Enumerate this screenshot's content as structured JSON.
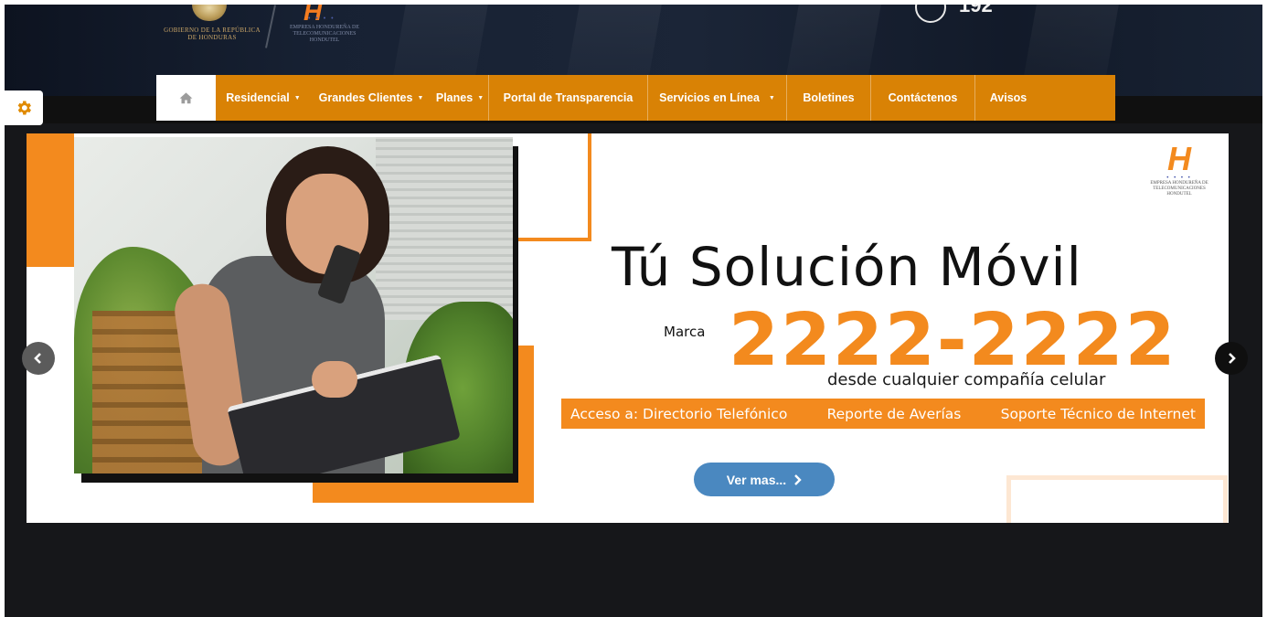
{
  "header": {
    "gov_text": "Gobierno de la República de Honduras",
    "brand_letter": "H",
    "brand_text": "Empresa Hondureña de Telecomunicaciones Hondutel",
    "phone_digits": "192"
  },
  "nav": {
    "home_icon": "home-icon",
    "items": [
      {
        "label": "Residencial",
        "dropdown": true
      },
      {
        "label": "Grandes Clientes",
        "dropdown": true
      },
      {
        "label": "Planes",
        "dropdown": true
      },
      {
        "label": "Portal de Transparencia",
        "dropdown": false
      },
      {
        "label": "Servicios en Línea",
        "dropdown": true
      },
      {
        "label": "Boletines",
        "dropdown": false
      },
      {
        "label": "Contáctenos",
        "dropdown": false
      },
      {
        "label": "Avisos",
        "dropdown": false
      }
    ]
  },
  "settings": {
    "icon": "gear-icon"
  },
  "slide": {
    "headline": "Tú Solución Móvil",
    "marca_label": "Marca",
    "number": "2222-2222",
    "subline": "desde cualquier compañía celular",
    "services": [
      "Acceso a: Directorio Telefónico",
      "Reporte de Averías",
      "Soporte Técnico de Internet"
    ],
    "button_label": "Ver mas...",
    "logo_letter": "H",
    "logo_text": "Empresa Hondureña de Telecomunicaciones Hondutel"
  },
  "colors": {
    "nav_bg": "#d98205",
    "accent_orange": "#f38a1e",
    "button_blue": "#4a88c0",
    "page_dark": "#16171a"
  }
}
